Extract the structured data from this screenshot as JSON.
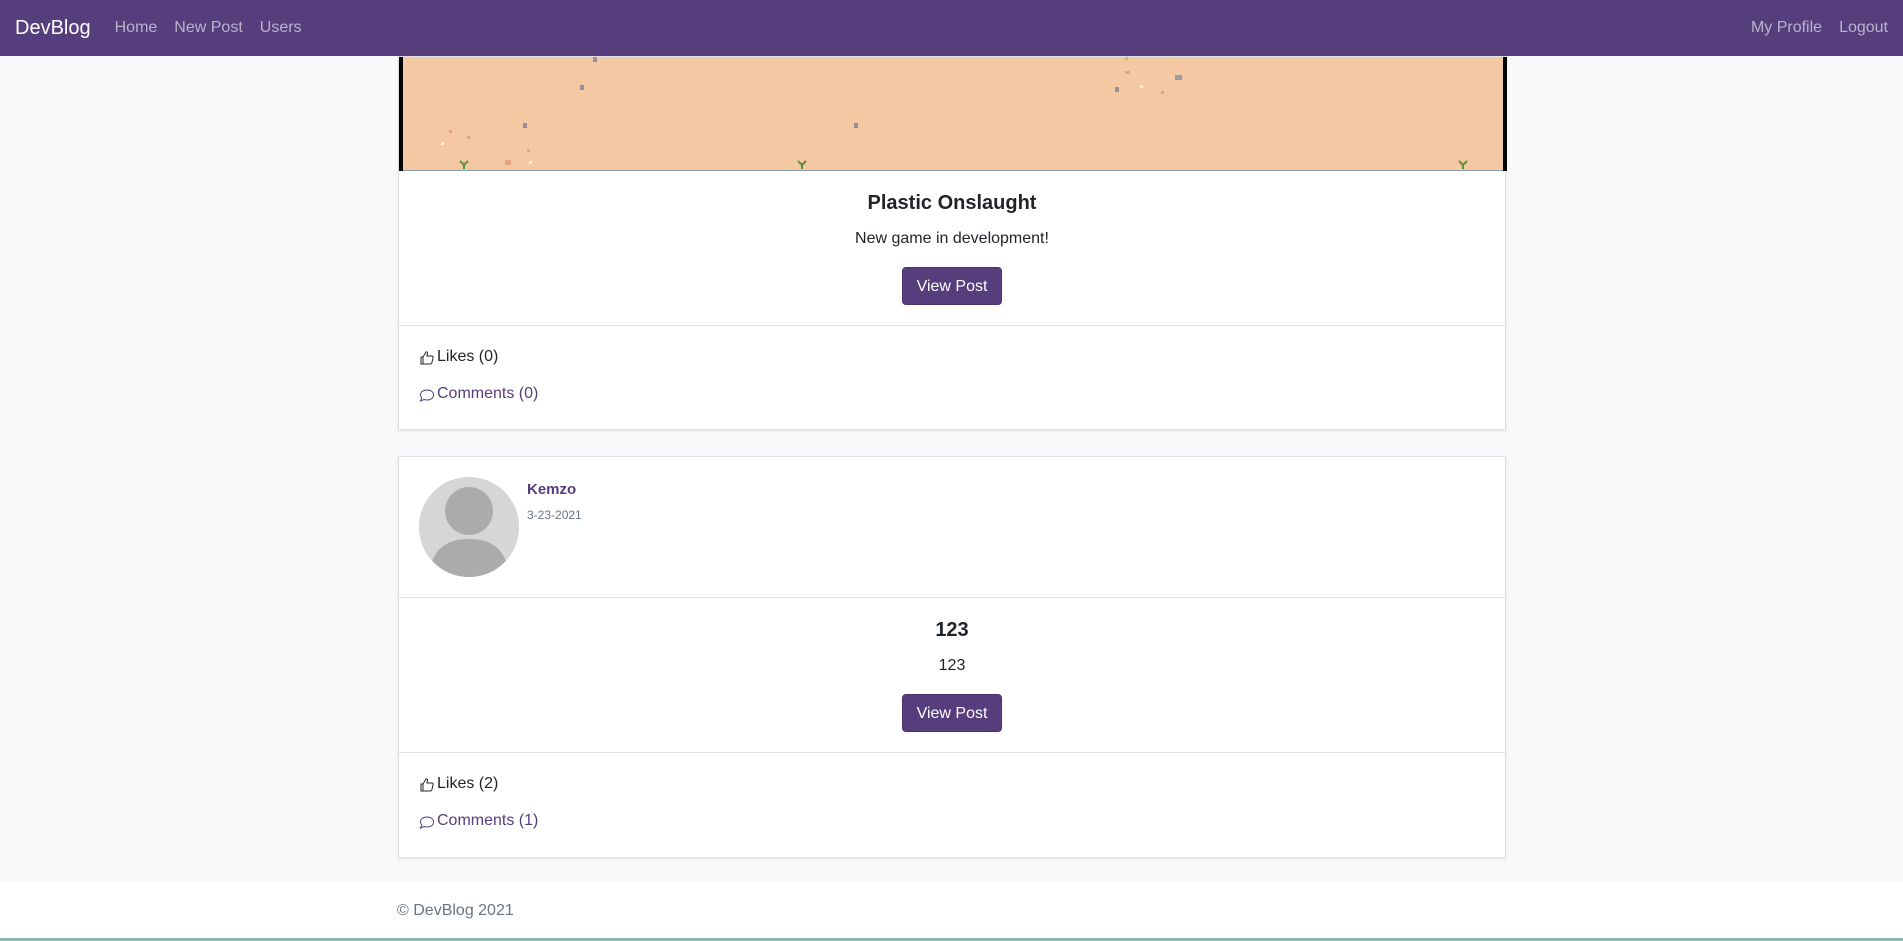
{
  "navbar": {
    "brand": "DevBlog",
    "links": [
      "Home",
      "New Post",
      "Users"
    ],
    "right_links": [
      "My Profile",
      "Logout"
    ]
  },
  "posts": [
    {
      "title": "Plastic Onslaught",
      "description": "New game in development!",
      "button": "View Post",
      "likes": "Likes (0)",
      "comments": "Comments (0)"
    },
    {
      "author": "Kemzo",
      "date": "3-23-2021",
      "title": "123",
      "description": "123",
      "button": "View Post",
      "likes": "Likes (2)",
      "comments": "Comments (1)"
    }
  ],
  "footer": {
    "copyright": "© DevBlog 2021"
  },
  "colors": {
    "brand": "#563d7c",
    "hero_bg": "#f3c8a2"
  },
  "icons": {
    "like": "thumbs-up-icon",
    "comment": "chat-bubble-icon"
  }
}
